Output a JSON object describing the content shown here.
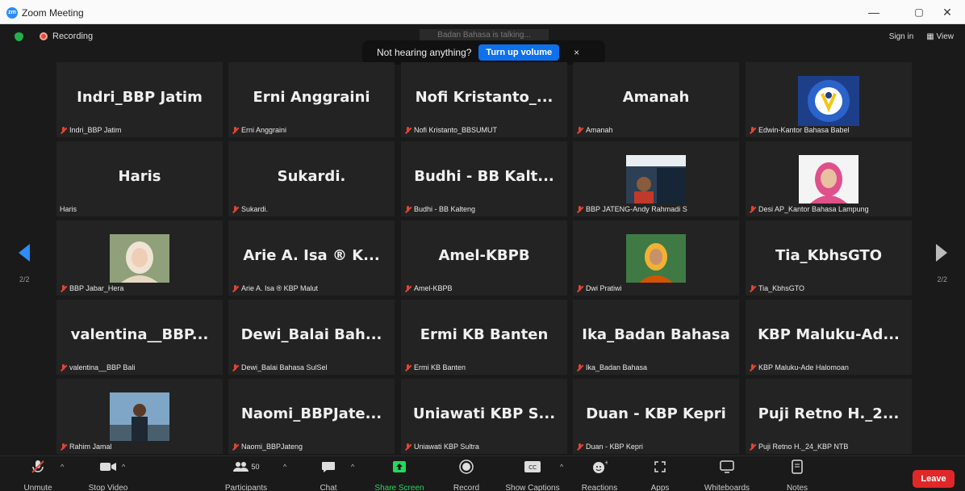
{
  "window": {
    "title": "Zoom Meeting",
    "logo": "zm",
    "minimize": "—",
    "restore": "▢",
    "close": "✕"
  },
  "top": {
    "recording": "Recording",
    "talking": "Badan Bahasa is talking...",
    "toast_message": "Not hearing anything?",
    "toast_button": "Turn up volume",
    "toast_close": "×",
    "sign_in": "Sign in",
    "view": "View"
  },
  "pages": {
    "left": "2/2",
    "right": "2/2"
  },
  "tiles": [
    {
      "big": "Indri_BBP Jatim",
      "name": "Indri_BBP Jatim",
      "muted": true
    },
    {
      "big": "Erni Anggraini",
      "name": "Erni Anggraini",
      "muted": true
    },
    {
      "big": "Nofi Kristanto_...",
      "name": "Nofi Kristanto_BBSUMUT",
      "muted": true
    },
    {
      "big": "Amanah",
      "name": "Amanah",
      "muted": true
    },
    {
      "big": "",
      "name": "Edwin-Kantor Bahasa Babel",
      "muted": true,
      "image": "logo"
    },
    {
      "big": "Haris",
      "name": "Haris",
      "muted": false
    },
    {
      "big": "Sukardi.",
      "name": "Sukardi.",
      "muted": true
    },
    {
      "big": "Budhi - BB Kalt...",
      "name": "Budhi - BB Kalteng",
      "muted": true
    },
    {
      "big": "",
      "name": "BBP JATENG-Andy Rahmadi S",
      "muted": true,
      "image": "man"
    },
    {
      "big": "",
      "name": "Desi AP_Kantor Bahasa Lampung",
      "muted": true,
      "image": "hijab-pink"
    },
    {
      "big": "",
      "name": "BBP Jabar_Hera",
      "muted": true,
      "image": "hijab-light"
    },
    {
      "big": "Arie A. Isa ® K...",
      "name": "Arie A. Isa ® KBP Malut",
      "muted": true
    },
    {
      "big": "Amel-KBPB",
      "name": "Amel-KBPB",
      "muted": true
    },
    {
      "big": "",
      "name": "Dwi Pratiwi",
      "muted": true,
      "image": "woman-green"
    },
    {
      "big": "Tia_KbhsGTO",
      "name": "Tia_KbhsGTO",
      "muted": true
    },
    {
      "big": "valentina__BBP...",
      "name": "valentina__BBP Bali",
      "muted": true
    },
    {
      "big": "Dewi_Balai Bah...",
      "name": "Dewi_Balai Bahasa SulSel",
      "muted": true
    },
    {
      "big": "Ermi KB Banten",
      "name": "Ermi KB Banten",
      "muted": true
    },
    {
      "big": "Ika_Badan Bahasa",
      "name": "Ika_Badan Bahasa",
      "muted": true
    },
    {
      "big": "KBP Maluku-Ad...",
      "name": "KBP Maluku-Ade Halomoan",
      "muted": true
    },
    {
      "big": "",
      "name": "Rahim Jamal",
      "muted": true,
      "image": "man-outdoor"
    },
    {
      "big": "Naomi_BBPJate...",
      "name": "Naomi_BBPJateng",
      "muted": true
    },
    {
      "big": "Uniawati KBP S...",
      "name": "Uniawati KBP Sultra",
      "muted": true
    },
    {
      "big": "Duan - KBP Kepri",
      "name": "Duan - KBP Kepri",
      "muted": true
    },
    {
      "big": "Puji Retno H._2...",
      "name": "Puji Retno H._24_KBP NTB",
      "muted": true
    }
  ],
  "toolbar": {
    "unmute": "Unmute",
    "stop_video": "Stop Video",
    "participants": "Participants",
    "participant_count": "50",
    "chat": "Chat",
    "share_screen": "Share Screen",
    "record": "Record",
    "show_captions": "Show Captions",
    "reactions": "Reactions",
    "apps": "Apps",
    "whiteboards": "Whiteboards",
    "notes": "Notes",
    "leave": "Leave",
    "share_color": "#23d959"
  }
}
